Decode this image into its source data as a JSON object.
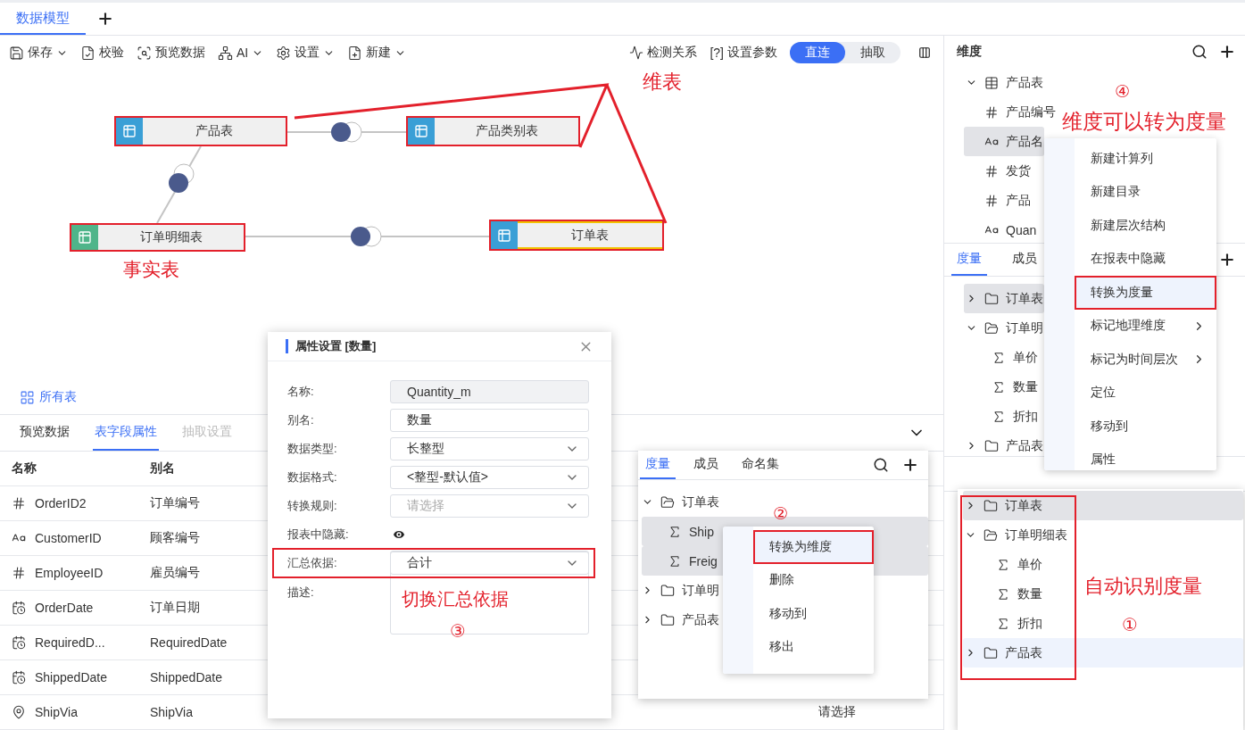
{
  "tabs": [
    {
      "label": "数据模型",
      "selected": true
    }
  ],
  "toolbar": {
    "left": [
      {
        "label": "保存",
        "menu": true
      },
      {
        "label": "校验",
        "menu": false
      },
      {
        "label": "预览数据",
        "menu": false
      },
      {
        "label": "AI",
        "menu": true
      },
      {
        "label": "设置",
        "menu": true
      },
      {
        "label": "新建",
        "menu": true
      }
    ],
    "right": [
      {
        "kind": "icon",
        "label": "检测关系"
      },
      {
        "kind": "prefix",
        "prefix": "[?]",
        "label": "设置参数"
      }
    ],
    "mode": [
      {
        "label": "直连",
        "selected": true
      },
      {
        "label": "抽取",
        "selected": false
      }
    ]
  },
  "canvas": {
    "nodes": [
      {
        "label": "产品表",
        "color": "#3a9fd6",
        "boxed": true,
        "selected": false
      },
      {
        "label": "产品类别表",
        "color": "#3a9fd6",
        "boxed": true,
        "selected": false
      },
      {
        "label": "订单明细表",
        "color": "#4fb58a",
        "boxed": true,
        "selected": false
      },
      {
        "label": "订单表",
        "color": "#3a9fd6",
        "boxed": true,
        "selected": true
      }
    ],
    "dimension_note": "维表",
    "fact_note": "事实表",
    "all_tables": "所有表"
  },
  "bottom_panel": {
    "tabs": [
      {
        "label": "预览数据",
        "selected": false,
        "disabled": false
      },
      {
        "label": "表字段属性",
        "selected": true,
        "disabled": false
      },
      {
        "label": "抽取设置",
        "selected": false,
        "disabled": true
      }
    ],
    "columns": [
      "名称",
      "别名"
    ],
    "rows": [
      {
        "kind": "number",
        "name": "OrderID2",
        "alias": "订单编号"
      },
      {
        "kind": "text",
        "name": "CustomerID",
        "alias": "顾客编号"
      },
      {
        "kind": "number",
        "name": "EmployeeID",
        "alias": "雇员编号"
      },
      {
        "kind": "date",
        "name": "OrderDate",
        "alias": "订单日期"
      },
      {
        "kind": "date",
        "name": "RequiredD...",
        "alias": "RequiredDate"
      },
      {
        "kind": "date",
        "name": "ShippedDate",
        "alias": "ShippedDate"
      },
      {
        "kind": "geo",
        "name": "ShipVia",
        "alias": "ShipVia",
        "column_3": "请选择"
      }
    ]
  },
  "dimension_panel": {
    "title": "维度",
    "tree": [
      {
        "kind": "table",
        "label": "产品表",
        "expanded": true,
        "selected": false,
        "children": [
          {
            "kind": "number",
            "label": "产品编号",
            "selected": false
          },
          {
            "kind": "text",
            "label": "产品名",
            "selected": true
          },
          {
            "kind": "number",
            "label": "发货",
            "selected": false
          },
          {
            "kind": "number",
            "label": "产品",
            "selected": false
          },
          {
            "kind": "text",
            "label": "Quan",
            "selected": false
          }
        ]
      }
    ]
  },
  "measure_panel": {
    "tabs": [
      {
        "label": "度量",
        "selected": true
      },
      {
        "label": "成员",
        "selected": false
      }
    ],
    "tree": [
      {
        "kind": "folder",
        "label": "订单表",
        "expanded": false,
        "selected": true
      },
      {
        "kind": "folder",
        "label": "订单明",
        "expanded": true,
        "selected": false,
        "children": [
          {
            "kind": "measure",
            "label": "单价",
            "selected": false
          },
          {
            "kind": "measure",
            "label": "数量",
            "selected": false
          },
          {
            "kind": "measure",
            "label": "折扣",
            "selected": false
          }
        ]
      },
      {
        "kind": "folder",
        "label": "产品表",
        "expanded": false,
        "selected": false
      }
    ]
  },
  "dimension_menu": {
    "items": [
      {
        "label": "新建计算列",
        "selected": false,
        "boxed": false,
        "submenu": false
      },
      {
        "label": "新建目录",
        "selected": false,
        "boxed": false,
        "submenu": false
      },
      {
        "label": "新建层次结构",
        "selected": false,
        "boxed": false,
        "submenu": false
      },
      {
        "label": "在报表中隐藏",
        "selected": false,
        "boxed": false,
        "submenu": false
      },
      {
        "label": "转换为度量",
        "selected": true,
        "boxed": true,
        "submenu": false
      },
      {
        "label": "标记地理维度",
        "selected": false,
        "boxed": false,
        "submenu": true
      },
      {
        "label": "标记为时间层次",
        "selected": false,
        "boxed": false,
        "submenu": true
      },
      {
        "label": "定位",
        "selected": false,
        "boxed": false,
        "submenu": false
      },
      {
        "label": "移动到",
        "selected": false,
        "boxed": false,
        "submenu": false
      },
      {
        "label": "属性",
        "selected": false,
        "boxed": false,
        "submenu": false
      }
    ],
    "note": "维度可以转为度量",
    "step": "④"
  },
  "property_dialog": {
    "title": "属性设置 [数量]",
    "fields": [
      {
        "kind": "readonly",
        "label": "名称:",
        "value": "Quantity_m"
      },
      {
        "kind": "input",
        "label": "别名:",
        "value": "数量"
      },
      {
        "kind": "select",
        "label": "数据类型:",
        "value": "长整型"
      },
      {
        "kind": "select",
        "label": "数据格式:",
        "value": "<整型-默认值>"
      },
      {
        "kind": "select",
        "label": "转换规则:",
        "placeholder": "请选择"
      },
      {
        "kind": "toggle",
        "label": "报表中隐藏:",
        "on": false
      },
      {
        "kind": "select",
        "label": "汇总依据:",
        "value": "合计",
        "boxed": true
      },
      {
        "kind": "textarea",
        "label": "描述:"
      }
    ],
    "note": "切换汇总依据",
    "step": "③"
  },
  "measure_popup": {
    "tabs": [
      {
        "label": "度量",
        "selected": true
      },
      {
        "label": "成员",
        "selected": false
      },
      {
        "label": "命名集",
        "selected": false
      }
    ],
    "tree": [
      {
        "kind": "folder",
        "label": "订单表",
        "expanded": true,
        "selected": false,
        "children": [
          {
            "kind": "measure",
            "label": "Ship",
            "selected": true
          },
          {
            "kind": "measure",
            "label": "Freig",
            "selected": true
          }
        ]
      },
      {
        "kind": "folder",
        "label": "订单明",
        "expanded": false,
        "selected": false
      },
      {
        "kind": "folder",
        "label": "产品表",
        "expanded": false,
        "selected": false
      }
    ],
    "menu": [
      {
        "label": "转换为维度",
        "selected": true,
        "boxed": true
      },
      {
        "label": "删除",
        "selected": false,
        "boxed": false
      },
      {
        "label": "移动到",
        "selected": false,
        "boxed": false
      },
      {
        "label": "移出",
        "selected": false,
        "boxed": false
      }
    ],
    "step": "②"
  },
  "auto_popup": {
    "tree": [
      {
        "kind": "folder",
        "label": "订单表",
        "expanded": false,
        "selected": true
      },
      {
        "kind": "folder",
        "label": "订单明细表",
        "expanded": true,
        "selected": false,
        "children": [
          {
            "kind": "measure",
            "label": "单价",
            "selected": false
          },
          {
            "kind": "measure",
            "label": "数量",
            "selected": false
          },
          {
            "kind": "measure",
            "label": "折扣",
            "selected": false
          }
        ]
      },
      {
        "kind": "folder",
        "label": "产品表",
        "expanded": false,
        "selected": false,
        "hovered": true
      }
    ],
    "note": "自动识别度量",
    "step": "①"
  }
}
